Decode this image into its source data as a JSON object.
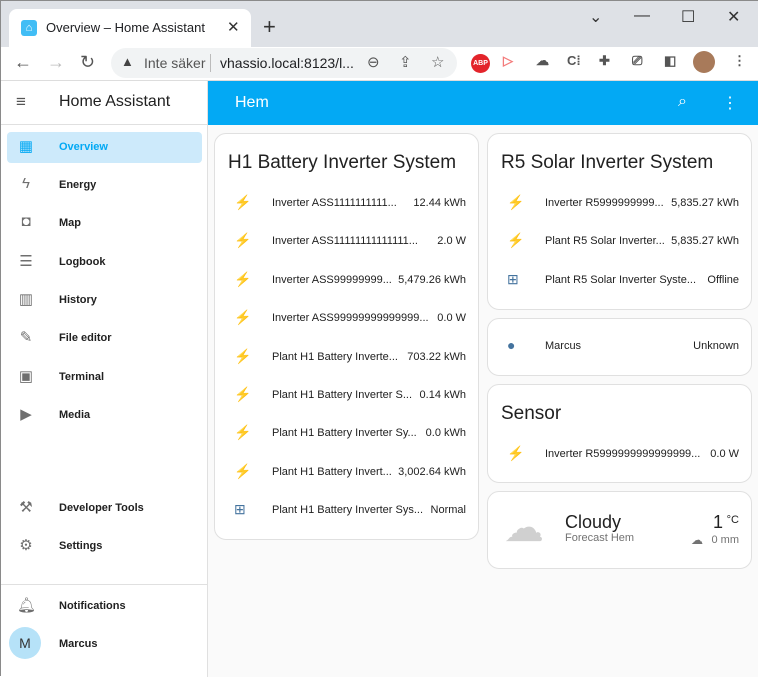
{
  "browser": {
    "tab_title": "Overview – Home Assistant",
    "security": "Inte säker",
    "url": "vhassio.local:8123/l...",
    "ext_abp": "ABP"
  },
  "sidebar": {
    "title": "Home Assistant",
    "items": [
      {
        "label": "Overview",
        "icon": "▦",
        "selected": true
      },
      {
        "label": "Energy",
        "icon": "ϟ"
      },
      {
        "label": "Map",
        "icon": "◘"
      },
      {
        "label": "Logbook",
        "icon": "☰"
      },
      {
        "label": "History",
        "icon": "▥"
      },
      {
        "label": "File editor",
        "icon": "✎"
      },
      {
        "label": "Terminal",
        "icon": "▣"
      },
      {
        "label": "Media",
        "icon": "▶"
      }
    ],
    "bottom": [
      {
        "label": "Developer Tools",
        "icon": "⚒"
      },
      {
        "label": "Settings",
        "icon": "⚙"
      }
    ],
    "notifications": "Notifications",
    "user": "Marcus",
    "user_initial": "M"
  },
  "header": {
    "title": "Hem"
  },
  "cards": {
    "h1": {
      "title": "H1 Battery Inverter System",
      "rows": [
        {
          "name": "Inverter ASS1111111111...",
          "value": "12.44 kWh",
          "icon": "solar-power"
        },
        {
          "name": "Inverter ASS11111111111111...",
          "value": "2.0 W",
          "icon": "solar-power"
        },
        {
          "name": "Inverter ASS99999999...",
          "value": "5,479.26 kWh",
          "icon": "solar-power"
        },
        {
          "name": "Inverter ASS99999999999999...",
          "value": "0.0 W",
          "icon": "solar-power"
        },
        {
          "name": "Plant H1 Battery Inverte...",
          "value": "703.22 kWh",
          "icon": "solar-power"
        },
        {
          "name": "Plant H1 Battery Inverter S...",
          "value": "0.14 kWh",
          "icon": "solar-power"
        },
        {
          "name": "Plant H1 Battery Inverter Sy...",
          "value": "0.0 kWh",
          "icon": "solar-power"
        },
        {
          "name": "Plant H1 Battery Invert...",
          "value": "3,002.64 kWh",
          "icon": "solar-power"
        },
        {
          "name": "Plant H1 Battery Inverter Sys...",
          "value": "Normal",
          "icon": "solar-panel"
        }
      ]
    },
    "r5": {
      "title": "R5 Solar Inverter System",
      "rows": [
        {
          "name": "Inverter R5999999999...",
          "value": "5,835.27 kWh",
          "icon": "solar-power"
        },
        {
          "name": "Plant R5 Solar Inverter...",
          "value": "5,835.27 kWh",
          "icon": "solar-power"
        },
        {
          "name": "Plant R5 Solar Inverter Syste...",
          "value": "Offline",
          "icon": "solar-panel"
        }
      ]
    },
    "person": {
      "rows": [
        {
          "name": "Marcus",
          "value": "Unknown",
          "icon": "account"
        }
      ]
    },
    "sensor": {
      "title": "Sensor",
      "rows": [
        {
          "name": "Inverter R5999999999999999...",
          "value": "0.0 W",
          "icon": "solar-power"
        }
      ]
    },
    "weather": {
      "condition": "Cloudy",
      "name": "Forecast Hem",
      "temp": "1",
      "unit": "°C",
      "precip": "0 mm"
    }
  },
  "colors": {
    "accent": "#03a9f4",
    "icon": "#44739e",
    "selected_bg": "#cdeafb"
  }
}
